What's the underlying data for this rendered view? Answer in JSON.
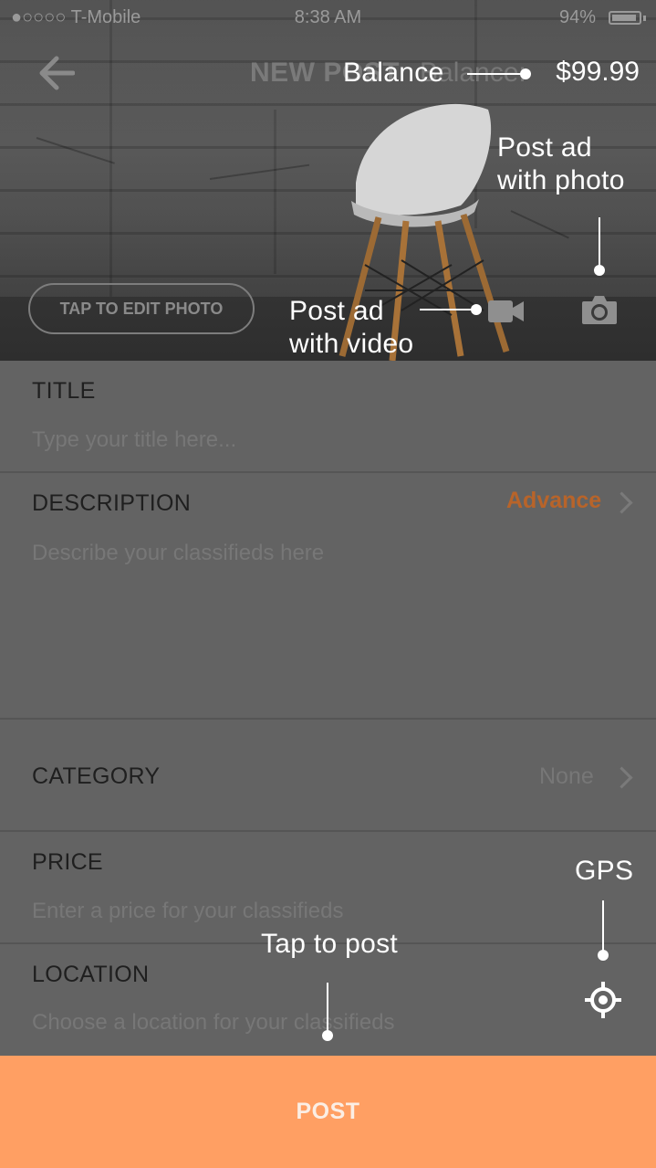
{
  "status_bar": {
    "carrier": "●○○○○ T-Mobile",
    "time": "8:38 AM",
    "battery": "94%"
  },
  "nav": {
    "title": "NEW POST",
    "balance_faded": "Balance:",
    "balance_label": "Balance",
    "balance_value": "$99.99"
  },
  "photo": {
    "edit_button": "TAP TO EDIT PHOTO"
  },
  "form": {
    "title_label": "TITLE",
    "title_placeholder": "Type your title here...",
    "description_label": "DESCRIPTION",
    "advance_link": "Advance",
    "description_placeholder": "Describe your classifieds here",
    "category_label": "CATEGORY",
    "category_value": "None",
    "price_label": "PRICE",
    "price_placeholder": "Enter a price for your classifieds",
    "location_label": "LOCATION",
    "location_placeholder": "Choose a location for your classifieds"
  },
  "post_button": "POST",
  "annotations": {
    "photo_line1": "Post ad",
    "photo_line2": "with photo",
    "video_line1": "Post ad",
    "video_line2": "with video",
    "gps": "GPS",
    "tap_to_post": "Tap to post"
  },
  "icons": {
    "back": "back-arrow-icon",
    "video": "video-camera-icon",
    "photo": "camera-icon",
    "gps": "gps-target-icon",
    "chevron": "chevron-right-icon"
  },
  "colors": {
    "accent": "#ff9f63",
    "advance": "#b8642a",
    "overlay_bg": "#636363"
  }
}
